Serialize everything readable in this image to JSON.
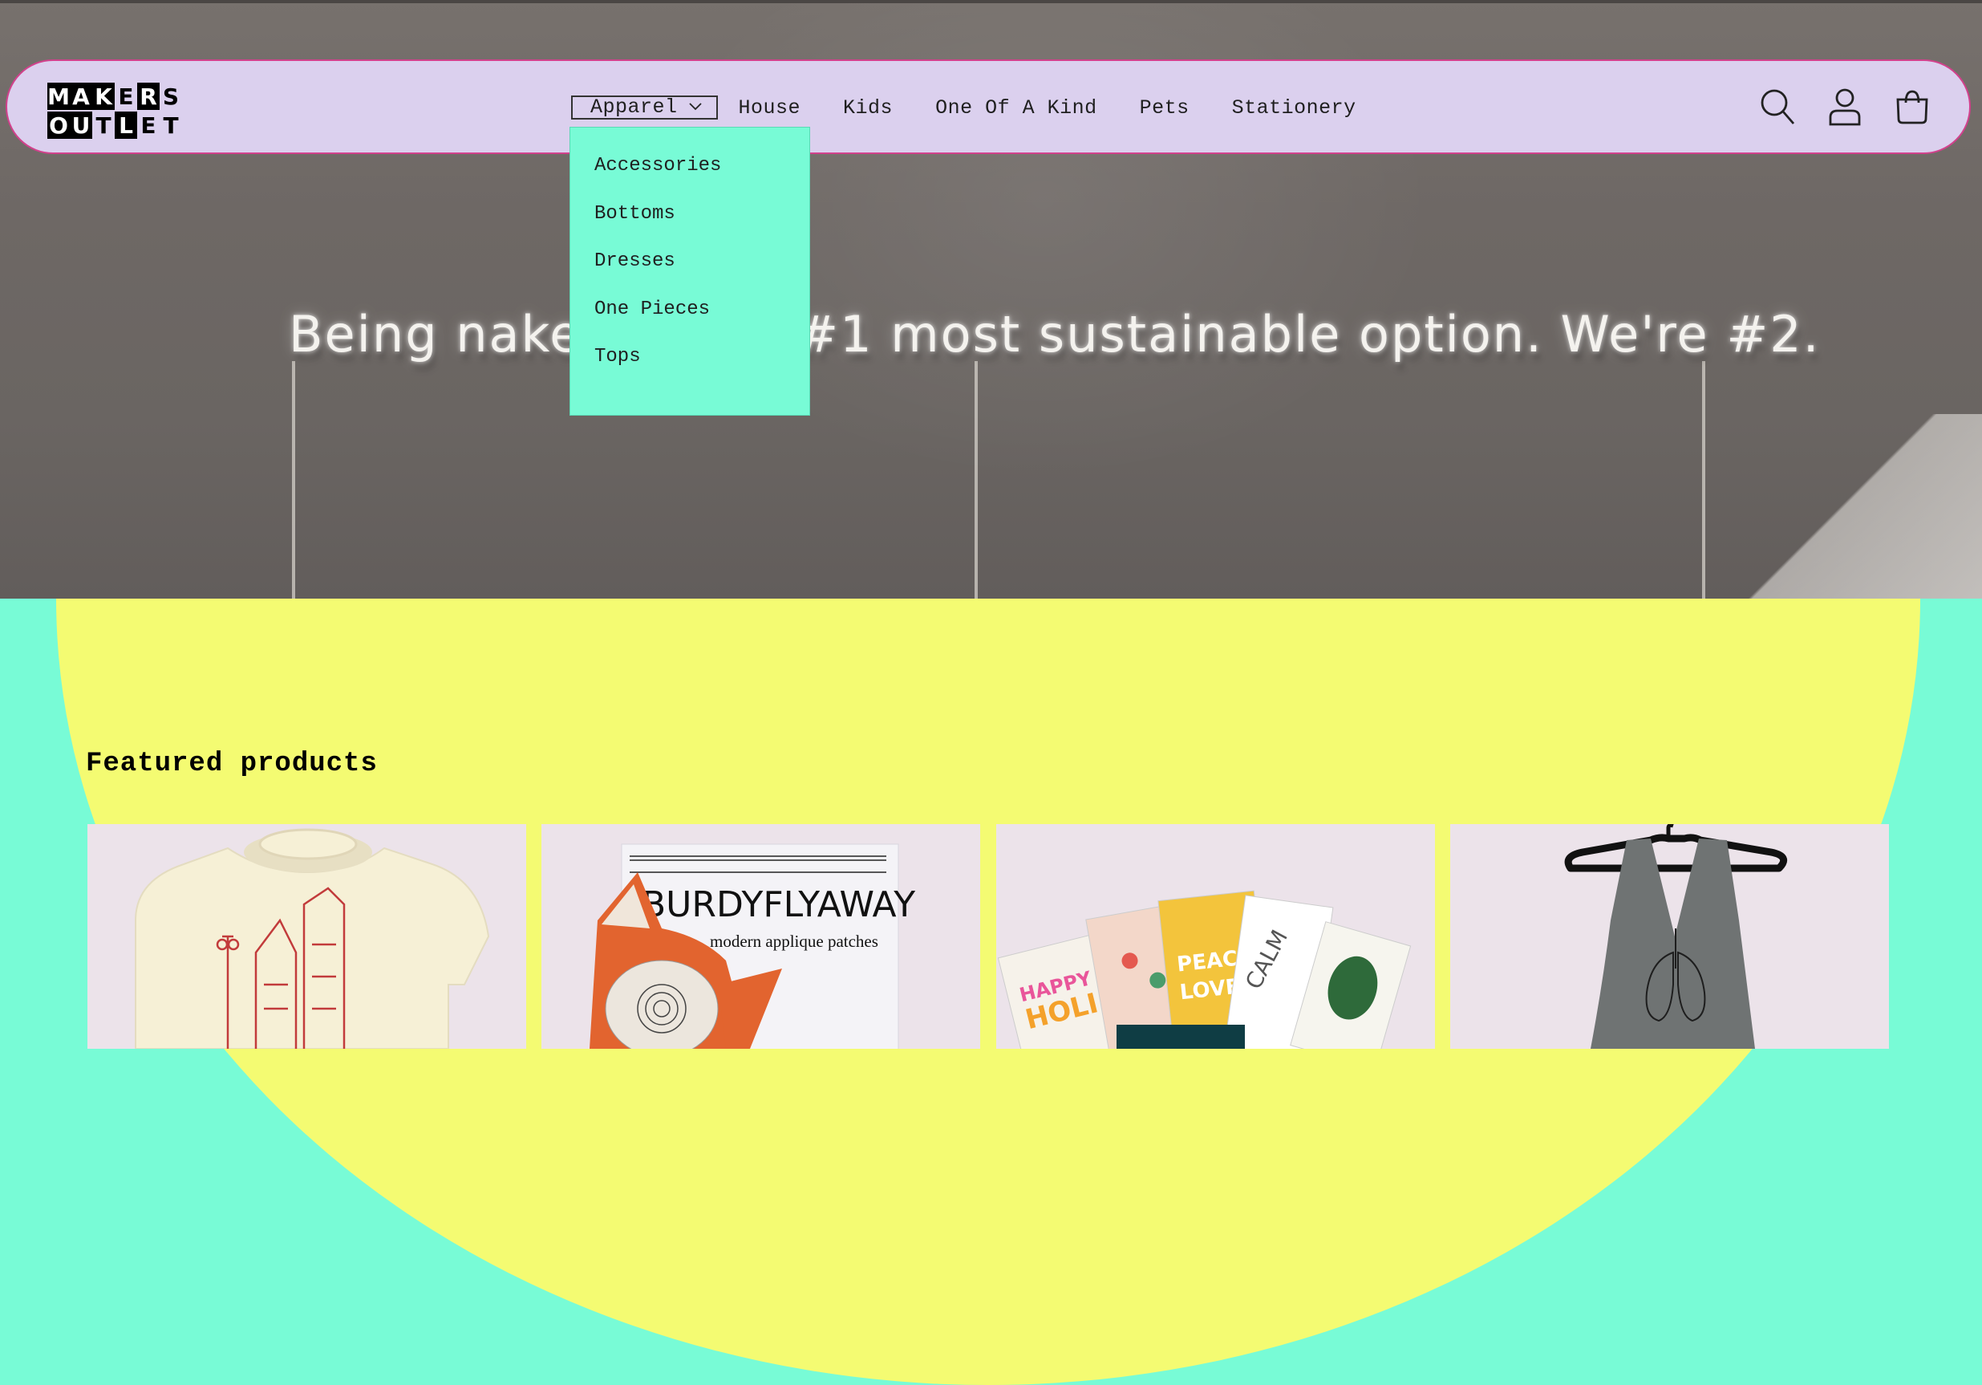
{
  "hero": {
    "neon_text": "Being naked is the #1 most sustainable option. We're #2."
  },
  "header": {
    "logo_letters": [
      "M",
      "A",
      "K",
      "E",
      "R",
      "S",
      "O",
      "U",
      "T",
      "L",
      "E",
      "T"
    ],
    "nav": [
      {
        "label": "Apparel",
        "active": true
      },
      {
        "label": "House"
      },
      {
        "label": "Kids"
      },
      {
        "label": "One Of A Kind"
      },
      {
        "label": "Pets"
      },
      {
        "label": "Stationery"
      }
    ],
    "icons": [
      "search-icon",
      "account-icon",
      "cart-icon"
    ]
  },
  "dropdown": {
    "items": [
      "Accessories",
      "Bottoms",
      "Dresses",
      "One Pieces",
      "Tops"
    ]
  },
  "featured": {
    "title": "Featured products",
    "cards": [
      {
        "name": "cream-tshirt-image"
      },
      {
        "name": "burdyflyaway-patches-image",
        "text1": "BURDYFLYAWAY",
        "text2": "modern applique patches"
      },
      {
        "name": "holiday-cards-image"
      },
      {
        "name": "grey-dress-image"
      }
    ]
  },
  "colors": {
    "header_bg": "#dbd0ee",
    "header_border": "#d2418c",
    "dropdown_bg": "#78fbd6",
    "section_yellow": "#f4fb72",
    "page_mint": "#78fbd6",
    "card_bg": "#ece3ea"
  }
}
